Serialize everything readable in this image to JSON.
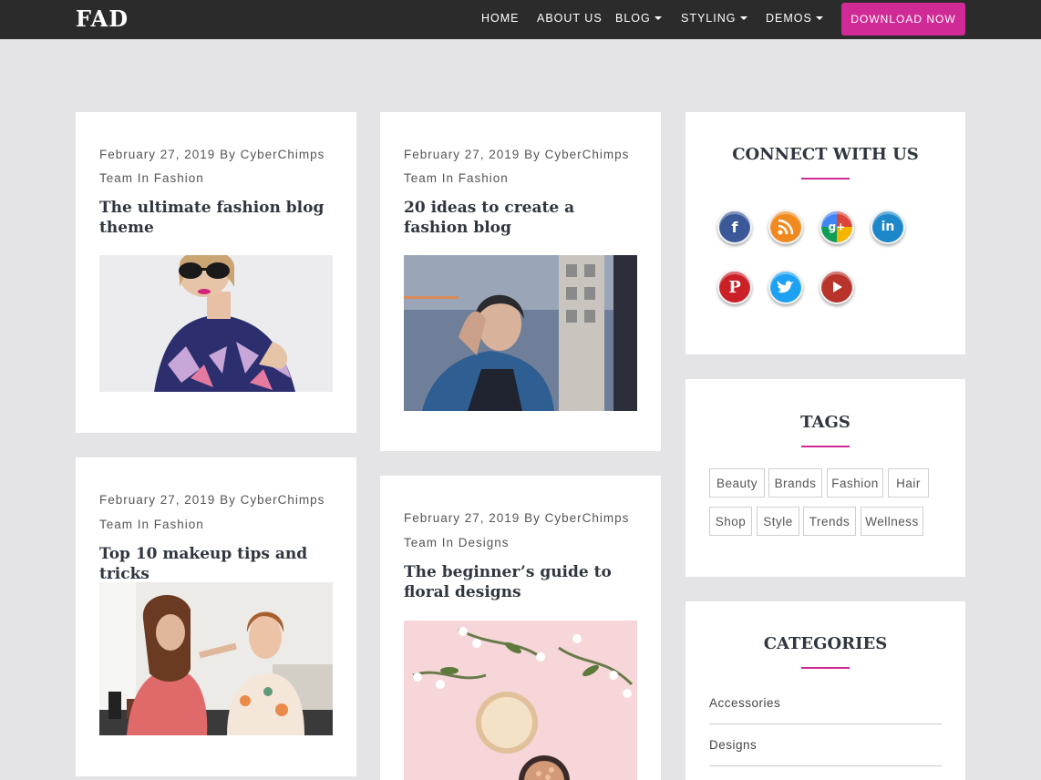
{
  "header": {
    "logo": "FAD",
    "nav": [
      {
        "label": "HOME"
      },
      {
        "label": "ABOUT US"
      },
      {
        "label": "BLOG"
      },
      {
        "label": "STYLING"
      },
      {
        "label": "DEMOS"
      }
    ],
    "download_label": "DOWNLOAD NOW"
  },
  "posts": [
    {
      "meta": "February 27, 2019 By CyberChimps",
      "team": "Team In Fashion",
      "title": "The ultimate fashion blog theme"
    },
    {
      "meta": "February 27, 2019 By CyberChimps",
      "team": "Team In Fashion",
      "title": "20 ideas to create a fashion blog"
    },
    {
      "meta": "February 27, 2019 By CyberChimps",
      "team": "Team In Fashion",
      "title": "Top 10 makeup tips and tricks"
    },
    {
      "meta": "February 27, 2019 By CyberChimps",
      "team": "Team In Designs",
      "title": "The beginner’s guide to floral designs"
    }
  ],
  "widgets": {
    "connect": {
      "title": "CONNECT WITH US",
      "icons": [
        "facebook-icon",
        "rss-icon",
        "google-plus-icon",
        "linkedin-icon",
        "pinterest-icon",
        "twitter-icon",
        "youtube-icon"
      ]
    },
    "tags": {
      "title": "TAGS",
      "items": [
        "Beauty",
        "Brands",
        "Fashion",
        "Hair",
        "Shop",
        "Style",
        "Trends",
        "Wellness"
      ]
    },
    "categories": {
      "title": "CATEGORIES",
      "items": [
        "Accessories",
        "Designs"
      ]
    }
  },
  "colors": {
    "accent": "#d02a96",
    "topbar": "#2b2b2b",
    "background": "#e4e4e6"
  }
}
